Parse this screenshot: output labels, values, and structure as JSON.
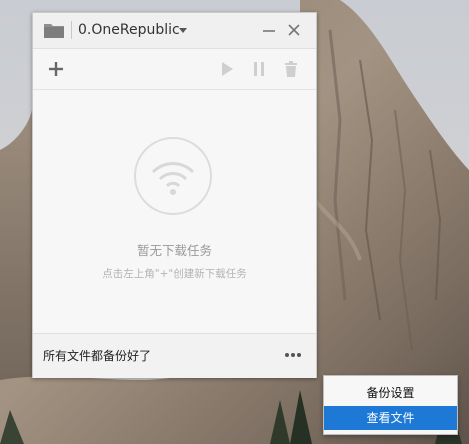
{
  "window": {
    "title": "0.OneRepublic"
  },
  "empty_state": {
    "title": "暂无下载任务",
    "hint": "点击左上角\"+\"创建新下载任务"
  },
  "status": {
    "text": "所有文件都备份好了"
  },
  "context_menu": {
    "items": [
      {
        "label": "备份设置"
      },
      {
        "label": "查看文件",
        "highlighted": true
      }
    ]
  },
  "colors": {
    "menu_highlight": "#1e78d6",
    "empty_text": "#9a9a9a"
  },
  "icons": [
    "folder-icon",
    "caret-down-icon",
    "minimize-icon",
    "close-icon",
    "plus-icon",
    "play-icon",
    "pause-icon",
    "trash-icon",
    "wifi-icon",
    "more-icon"
  ]
}
